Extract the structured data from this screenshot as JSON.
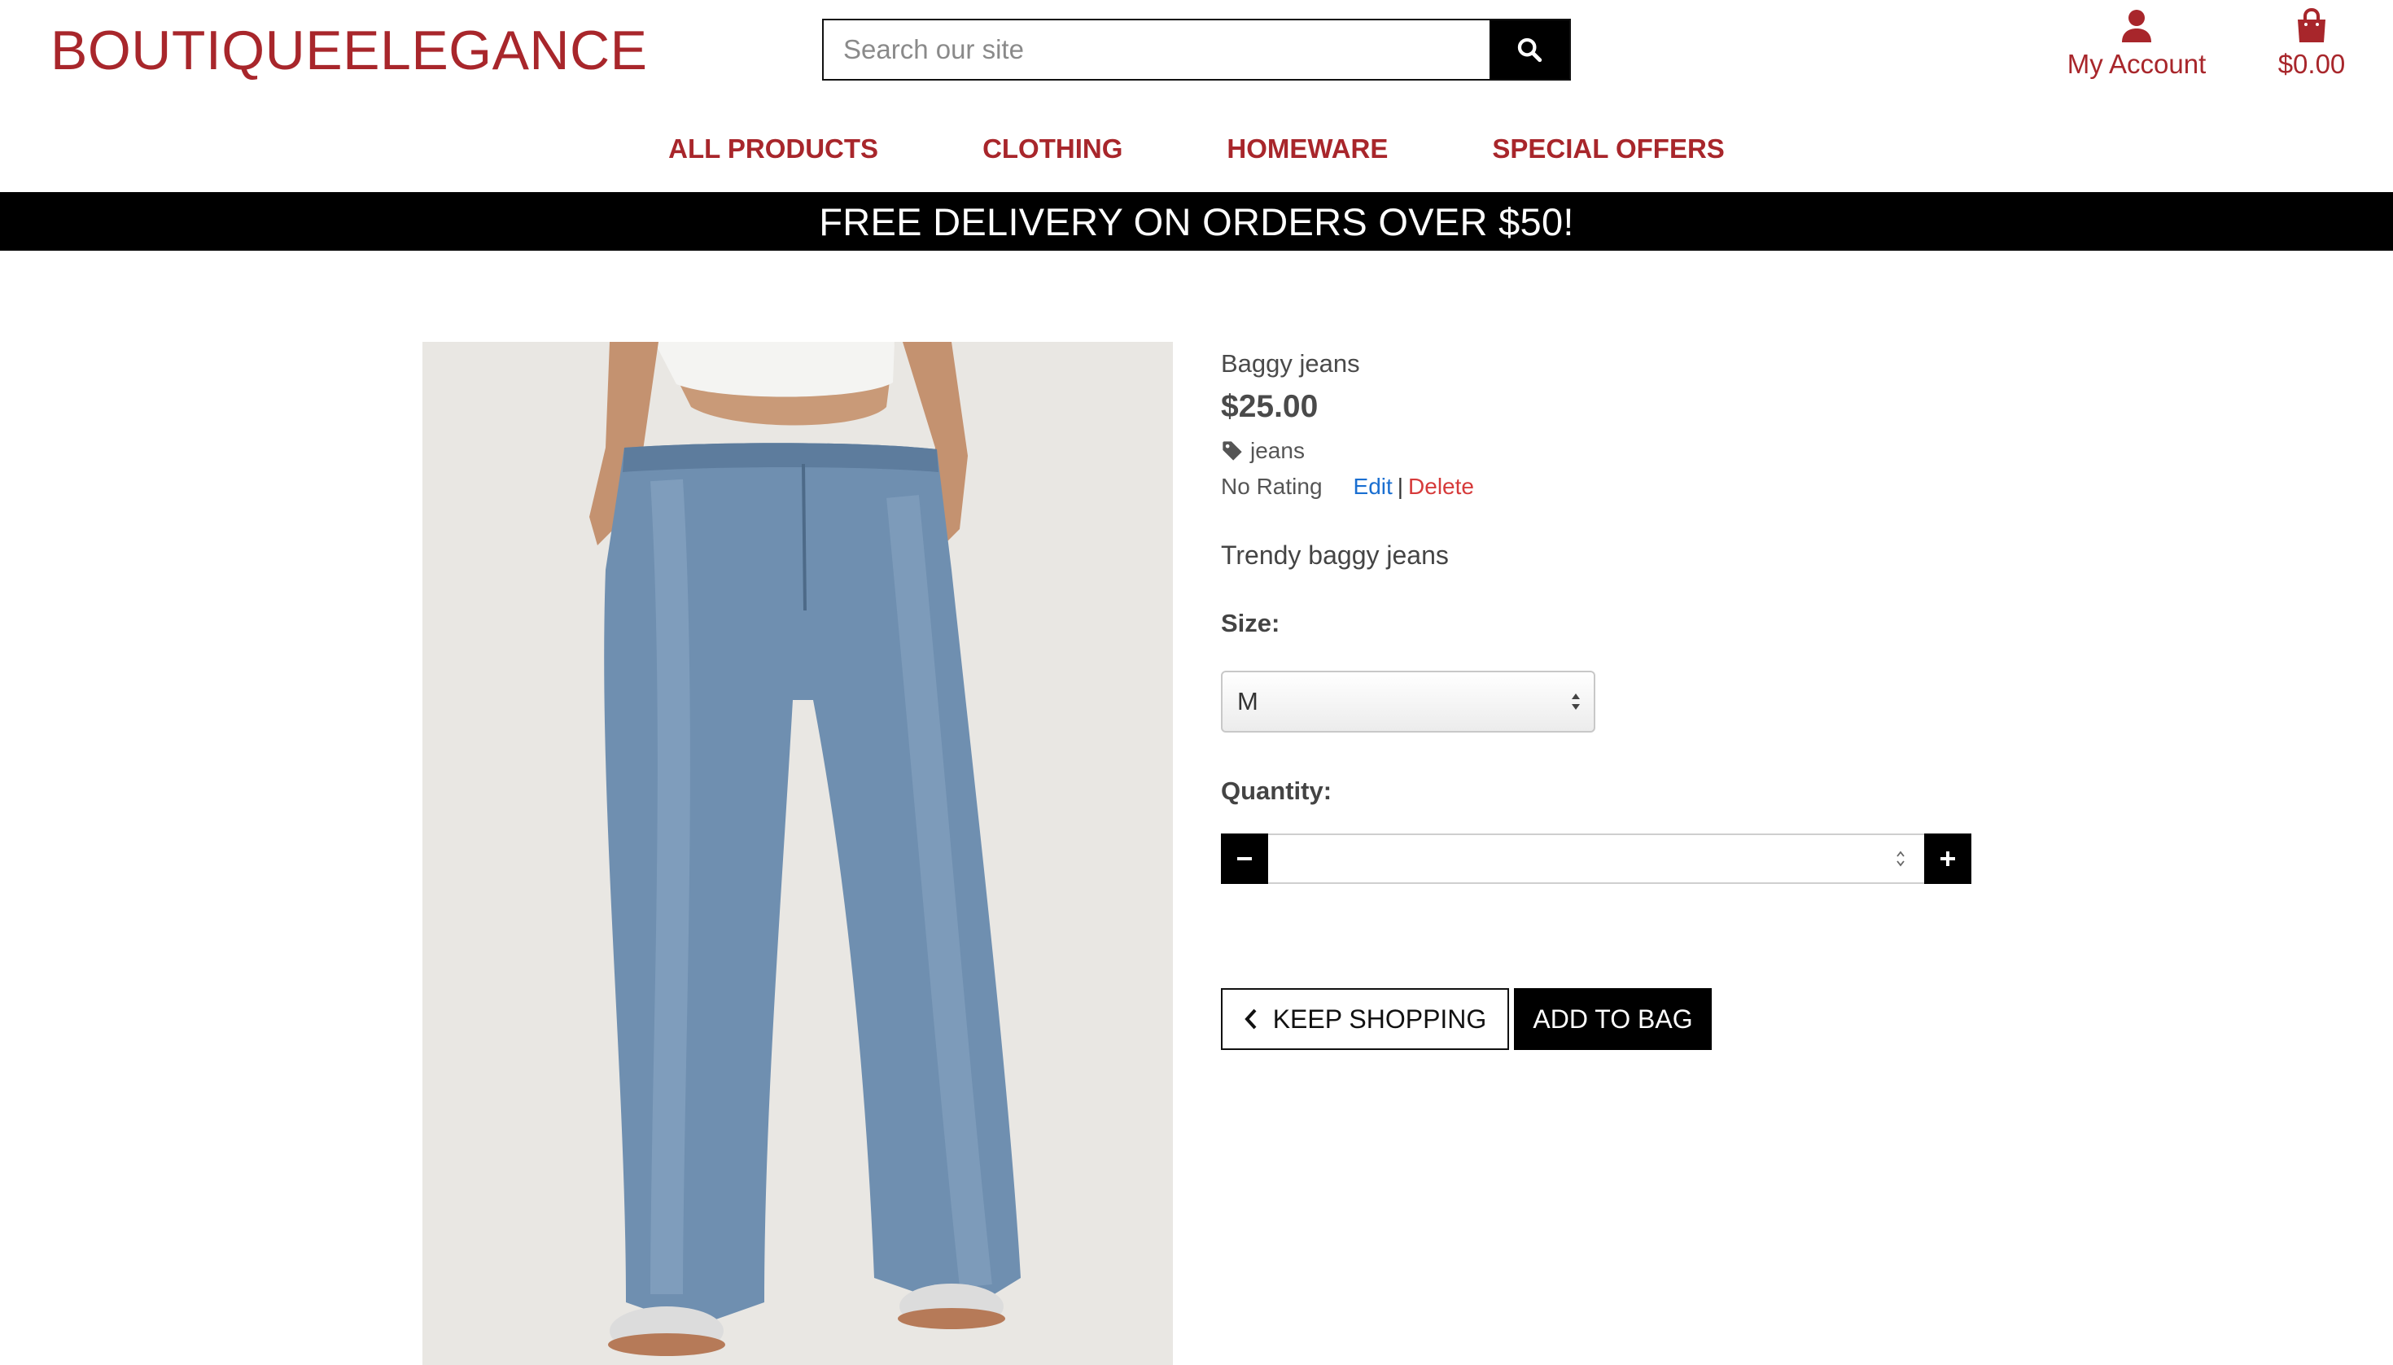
{
  "header": {
    "brand": "BOUTIQUEELEGANCE",
    "search_placeholder": "Search our site",
    "account_label": "My Account",
    "bag_total": "$0.00",
    "accent_color": "#a8262b"
  },
  "nav": {
    "items": [
      {
        "label": "ALL PRODUCTS"
      },
      {
        "label": "CLOTHING"
      },
      {
        "label": "HOMEWARE"
      },
      {
        "label": "SPECIAL OFFERS"
      }
    ]
  },
  "banner": {
    "text": "FREE DELIVERY ON ORDERS OVER $50!"
  },
  "product": {
    "name": "Baggy jeans",
    "price": "$25.00",
    "category": "jeans",
    "rating": "No Rating",
    "edit_label": "Edit",
    "separator": "|",
    "delete_label": "Delete",
    "description": "Trendy baggy jeans",
    "size_label": "Size:",
    "size_selected": "M",
    "quantity_label": "Quantity:",
    "quantity_value": ""
  },
  "actions": {
    "keep_shopping": "KEEP SHOPPING",
    "add_to_bag": "ADD TO BAG"
  },
  "icons": {
    "search": "search-icon",
    "account": "user-icon",
    "bag": "shopping-bag-icon",
    "tag": "tag-icon",
    "minus": "minus-icon",
    "plus": "plus-icon",
    "back": "chevron-left-icon"
  }
}
